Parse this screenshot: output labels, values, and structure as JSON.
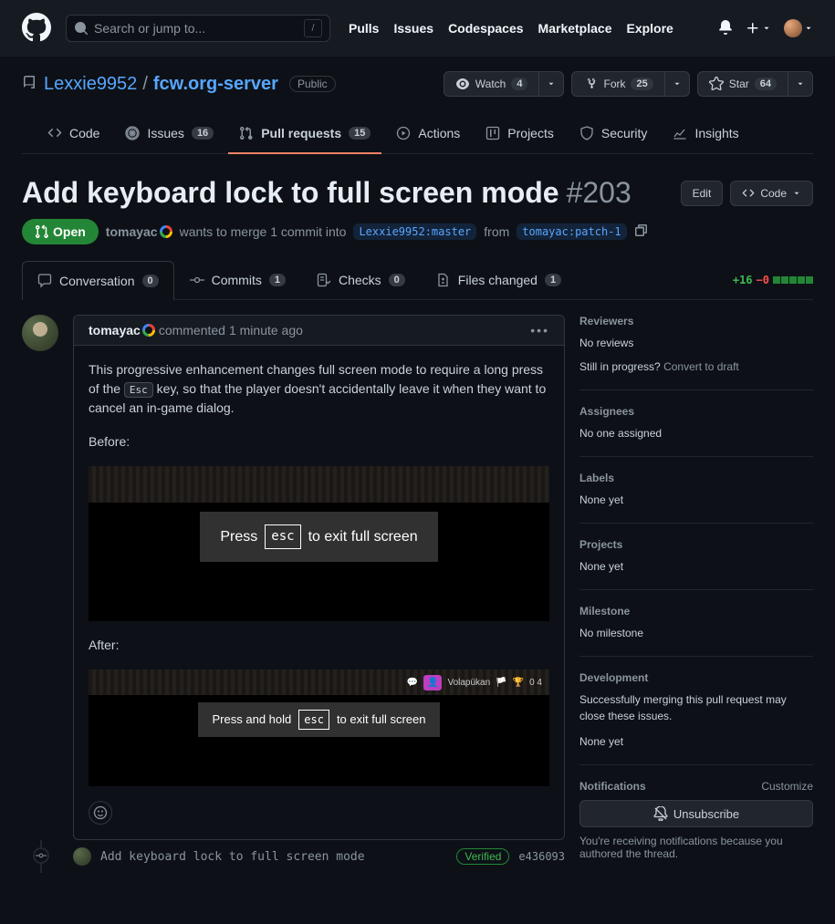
{
  "header": {
    "search_placeholder": "Search or jump to...",
    "nav": [
      "Pulls",
      "Issues",
      "Codespaces",
      "Marketplace",
      "Explore"
    ]
  },
  "repo": {
    "owner": "Lexxie9952",
    "name": "fcw.org-server",
    "visibility": "Public",
    "watch_label": "Watch",
    "watch_count": "4",
    "fork_label": "Fork",
    "fork_count": "25",
    "star_label": "Star",
    "star_count": "64"
  },
  "repo_tabs": {
    "code": "Code",
    "issues": "Issues",
    "issues_count": "16",
    "pulls": "Pull requests",
    "pulls_count": "15",
    "actions": "Actions",
    "projects": "Projects",
    "security": "Security",
    "insights": "Insights"
  },
  "pr": {
    "title": "Add keyboard lock to full screen mode",
    "number": "#203",
    "edit": "Edit",
    "code_btn": "Code",
    "state": "Open",
    "author": "tomayac",
    "meta_wants": "wants to merge 1 commit into",
    "base_branch": "Lexxie9952:master",
    "from_label": "from",
    "head_branch": "tomayac:patch-1"
  },
  "pr_tabs": {
    "conversation": "Conversation",
    "conversation_count": "0",
    "commits": "Commits",
    "commits_count": "1",
    "checks": "Checks",
    "checks_count": "0",
    "files": "Files changed",
    "files_count": "1",
    "additions": "+16",
    "deletions": "−0"
  },
  "comment": {
    "author": "tomayac",
    "time_prefix": "commented",
    "time": "1 minute ago",
    "body_line1_a": "This progressive enhancement changes full screen mode to require a long press of the ",
    "body_line1_key": "Esc",
    "body_line1_b": " key, so that the player doesn't accidentally leave it when they want to cancel an in-game dialog.",
    "before_label": "Before:",
    "after_label": "After:",
    "before_banner_a": "Press",
    "before_banner_key": "esc",
    "before_banner_b": "to exit full screen",
    "after_banner_a": "Press and hold",
    "after_banner_key": "esc",
    "after_banner_b": "to exit full screen",
    "after_top_text": "Volapükan",
    "after_top_stats": "0   4"
  },
  "commit_row": {
    "message": "Add keyboard lock to full screen mode",
    "verified": "Verified",
    "sha": "e436093"
  },
  "sidebar": {
    "reviewers_head": "Reviewers",
    "reviewers_text": "No reviews",
    "reviewers_prog": "Still in progress?",
    "reviewers_convert": "Convert to draft",
    "assignees_head": "Assignees",
    "assignees_text": "No one assigned",
    "labels_head": "Labels",
    "labels_text": "None yet",
    "projects_head": "Projects",
    "projects_text": "None yet",
    "milestone_head": "Milestone",
    "milestone_text": "No milestone",
    "development_head": "Development",
    "development_text": "Successfully merging this pull request may close these issues.",
    "development_none": "None yet",
    "notifications_head": "Notifications",
    "customize": "Customize",
    "unsubscribe": "Unsubscribe",
    "notif_reason": "You're receiving notifications because you authored the thread."
  }
}
